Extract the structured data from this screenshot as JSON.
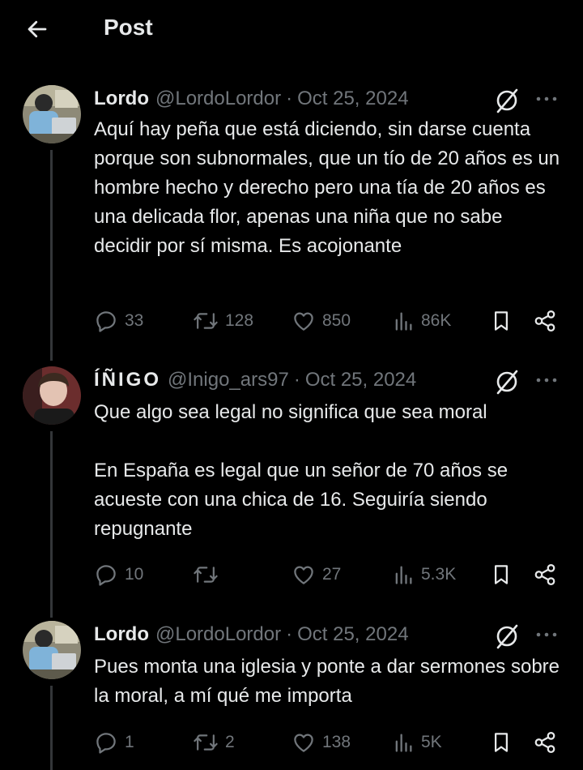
{
  "header": {
    "title": "Post"
  },
  "tweets": [
    {
      "name": "Lordo",
      "handle": "@LordoLordor",
      "separator": "·",
      "date": "Oct 25, 2024",
      "text": "Aquí hay peña que está diciendo, sin darse cuenta porque son subnormales, que un tío de 20 años es un hombre hecho y derecho pero una tía de 20 años es una delicada flor, apenas una niña que no sabe decidir por sí misma. Es acojonante",
      "replies": "33",
      "reposts": "128",
      "likes": "850",
      "views": "86K"
    },
    {
      "name": "ÍÑIGO",
      "handle": "@Inigo_ars97",
      "separator": "·",
      "date": "Oct 25, 2024",
      "text": "Que algo sea legal no significa que sea moral\n\nEn España es legal que un señor de 70 años se acueste con una chica de 16. Seguiría siendo repugnante",
      "replies": "10",
      "reposts": "",
      "likes": "27",
      "views": "5.3K"
    },
    {
      "name": "Lordo",
      "handle": "@LordoLordor",
      "separator": "·",
      "date": "Oct 25, 2024",
      "text": "Pues monta una iglesia y ponte a dar sermones sobre la moral, a mí qué me importa",
      "replies": "1",
      "reposts": "2",
      "likes": "138",
      "views": "5K"
    }
  ],
  "icons": {
    "back": "arrow-left-icon",
    "grok": "grok-icon",
    "more": "more-icon",
    "reply": "reply-icon",
    "repost": "repost-icon",
    "like": "heart-icon",
    "views": "views-icon",
    "bookmark": "bookmark-icon",
    "share": "share-icon"
  },
  "colors": {
    "background": "#000000",
    "text": "#e7e9ea",
    "muted": "#71767b"
  }
}
